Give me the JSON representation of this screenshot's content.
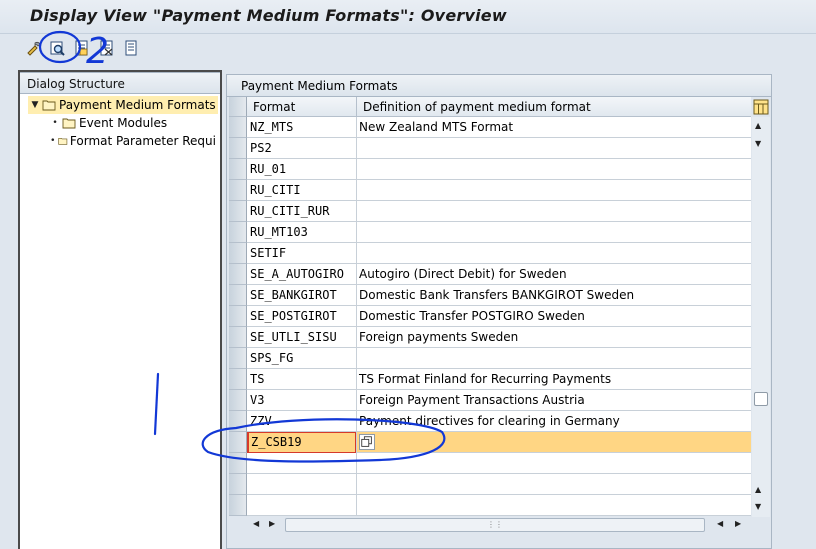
{
  "window": {
    "title": "Display View \"Payment Medium Formats\": Overview"
  },
  "toolbar": {
    "buttons": [
      {
        "name": "display-change-icon"
      },
      {
        "name": "details-icon"
      },
      {
        "name": "select-all-icon"
      },
      {
        "name": "deselect-all-icon"
      },
      {
        "name": "print-icon"
      }
    ]
  },
  "dialog_structure": {
    "header": "Dialog Structure",
    "items": [
      {
        "label": "Payment Medium Formats",
        "level": 0,
        "expanded": true,
        "selected": true
      },
      {
        "label": "Event Modules",
        "level": 1
      },
      {
        "label": "Format Parameter Requi",
        "level": 1
      }
    ]
  },
  "table": {
    "title": "Payment Medium Formats",
    "columns": [
      "Format",
      "Definition of payment medium format"
    ],
    "rows": [
      {
        "format": "NZ_MTS",
        "definition": "New Zealand MTS Format"
      },
      {
        "format": "PS2",
        "definition": ""
      },
      {
        "format": "RU_01",
        "definition": ""
      },
      {
        "format": "RU_CITI",
        "definition": ""
      },
      {
        "format": "RU_CITI_RUR",
        "definition": ""
      },
      {
        "format": "RU_MT103",
        "definition": ""
      },
      {
        "format": "SETIF",
        "definition": ""
      },
      {
        "format": "SE_A_AUTOGIRO",
        "definition": "Autogiro (Direct Debit) for Sweden"
      },
      {
        "format": "SE_BANKGIROT",
        "definition": "Domestic Bank Transfers BANKGIROT Sweden"
      },
      {
        "format": "SE_POSTGIROT",
        "definition": "Domestic Transfer POSTGIRO Sweden"
      },
      {
        "format": "SE_UTLI_SISU",
        "definition": "Foreign payments Sweden"
      },
      {
        "format": "SPS_FG",
        "definition": ""
      },
      {
        "format": "TS",
        "definition": "TS Format Finland for Recurring Payments"
      },
      {
        "format": "V3",
        "definition": "Foreign Payment Transactions Austria"
      },
      {
        "format": "ZZV",
        "definition": "Payment directives for clearing in Germany"
      },
      {
        "format": "Z_CSB19",
        "definition": "",
        "highlighted": true
      }
    ]
  },
  "colors": {
    "highlight_row": "#ffd684",
    "selected_tree": "#ffeeb0",
    "annotation": "#1238d6"
  },
  "annotations": {
    "marks": [
      "2",
      "1"
    ]
  }
}
